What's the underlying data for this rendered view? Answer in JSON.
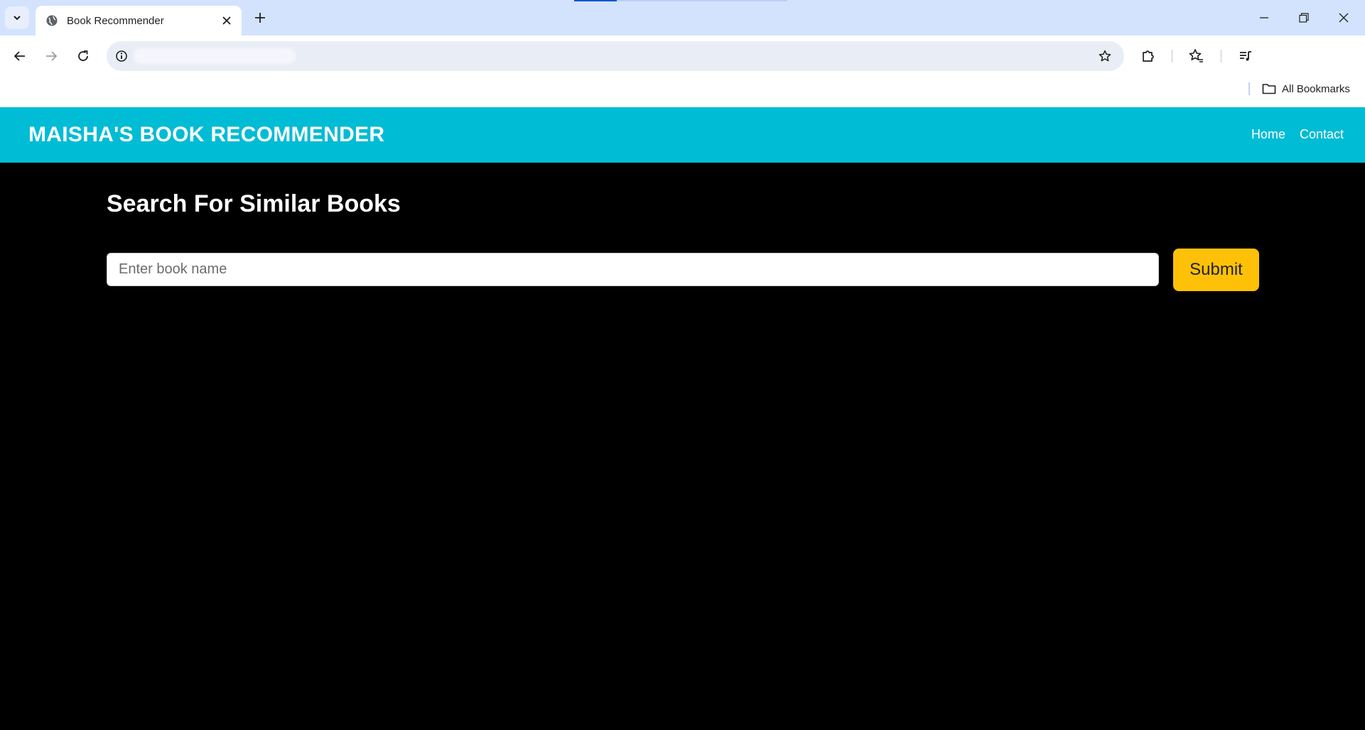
{
  "browser": {
    "tab_title": "Book Recommender",
    "bookmarks_label": "All Bookmarks",
    "url": ""
  },
  "site": {
    "brand": "MAISHA'S BOOK RECOMMENDER",
    "nav": [
      "Home",
      "Contact"
    ],
    "heading": "Search For Similar Books",
    "search_placeholder": "Enter book name",
    "submit_label": "Submit",
    "colors": {
      "navbar": "#00bcd4",
      "submit": "#ffc107",
      "background": "#000000"
    }
  }
}
